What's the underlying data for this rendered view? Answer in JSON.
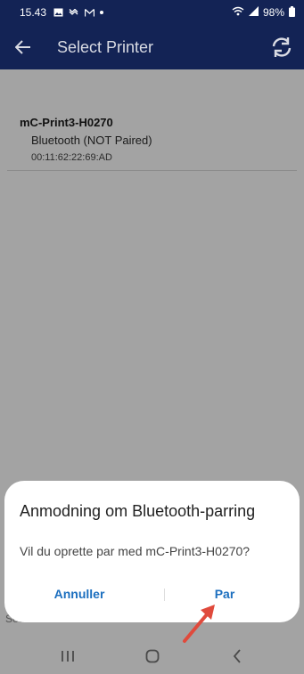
{
  "status_bar": {
    "time": "15.43",
    "battery": "98%",
    "icons": [
      "gallery-icon",
      "voicemail-icon",
      "mail-icon",
      "dot-icon",
      "wifi-icon",
      "signal-icon",
      "battery-icon"
    ]
  },
  "app_bar": {
    "title": "Select Printer",
    "back_icon": "arrow-left-icon",
    "refresh_icon": "refresh-icon"
  },
  "printer": {
    "name": "mC-Print3-H0270",
    "status": "Bluetooth (NOT Paired)",
    "mac": "00:11:62:22:69:AD"
  },
  "footer": {
    "search_interface": "Search Interface : Bluetooth / LAN / USB"
  },
  "dialog": {
    "title": "Anmodning om Bluetooth-parring",
    "message": "Vil du oprette par med mC-Print3-H0270?",
    "cancel_label": "Annuller",
    "ok_label": "Par"
  },
  "nav_bar": {
    "icons": [
      "recents-icon",
      "home-icon",
      "back-icon"
    ]
  },
  "colors": {
    "header_bg": "#132355",
    "overlay_bg": "#a3a3a3",
    "dialog_bg": "#ffffff",
    "button_text": "#1c6fbf",
    "arrow": "#e04a3c"
  }
}
